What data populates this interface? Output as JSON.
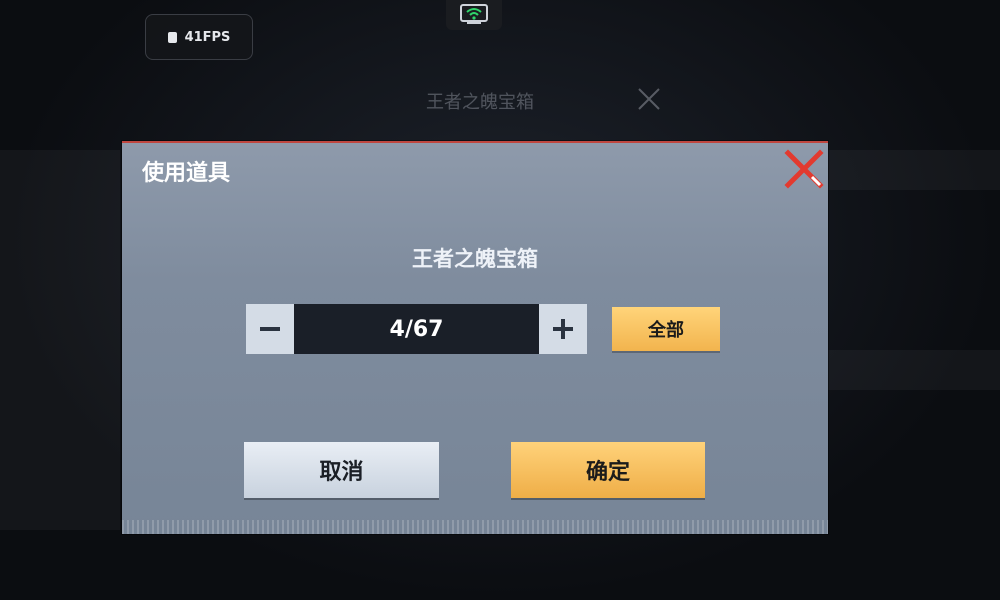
{
  "overlay": {
    "fps_label": "41FPS",
    "background_title": "王者之魄宝箱"
  },
  "dialog": {
    "title": "使用道具",
    "item_name": "王者之魄宝箱",
    "quantity": "4/67",
    "all_label": "全部",
    "cancel_label": "取消",
    "confirm_label": "确定"
  },
  "icons": {
    "close": "close-icon",
    "minus": "minus-icon",
    "plus": "plus-icon",
    "wifi": "wifi-icon",
    "chip": "chip-icon"
  },
  "colors": {
    "accent_gold": "#f2b44e",
    "close_red": "#e23a2f",
    "dialog_bg": "#8796a8"
  }
}
